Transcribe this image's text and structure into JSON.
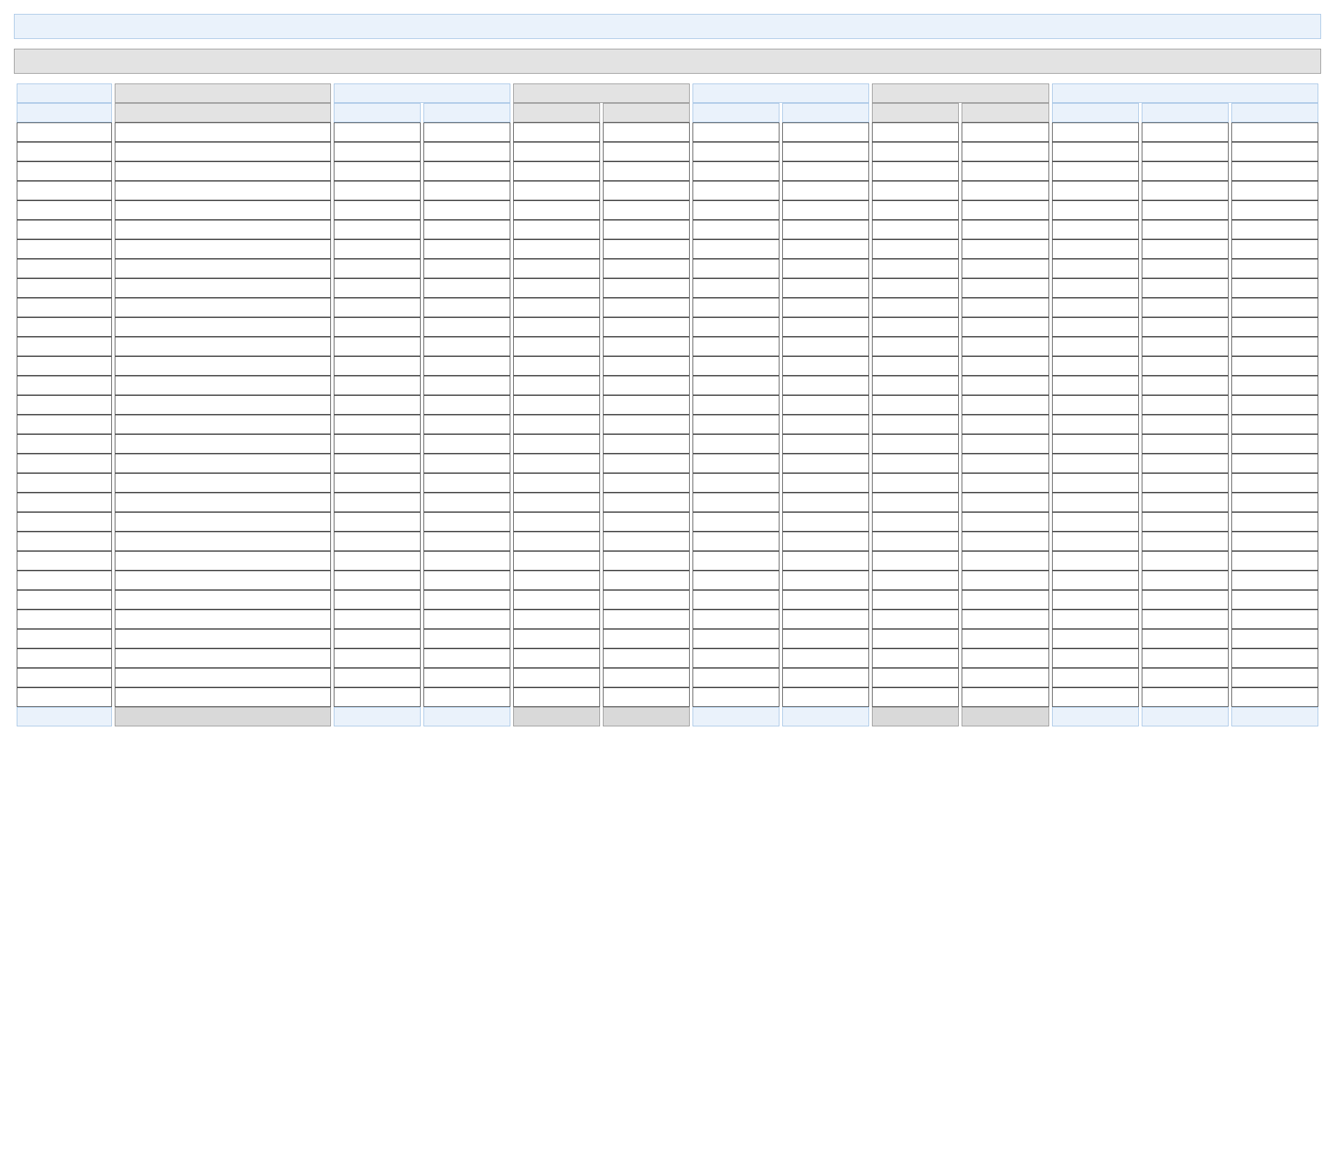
{
  "bars": {
    "title": "",
    "subtitle": ""
  },
  "table": {
    "headerRow1": [
      "",
      "",
      "",
      "",
      "",
      "",
      ""
    ],
    "headerRow2": [
      "",
      "",
      "",
      "",
      "",
      "",
      "",
      "",
      "",
      "",
      "",
      "",
      ""
    ],
    "footer": [
      "",
      "",
      "",
      "",
      "",
      "",
      "",
      "",
      "",
      "",
      "",
      "",
      ""
    ],
    "rowCount": 30
  }
}
